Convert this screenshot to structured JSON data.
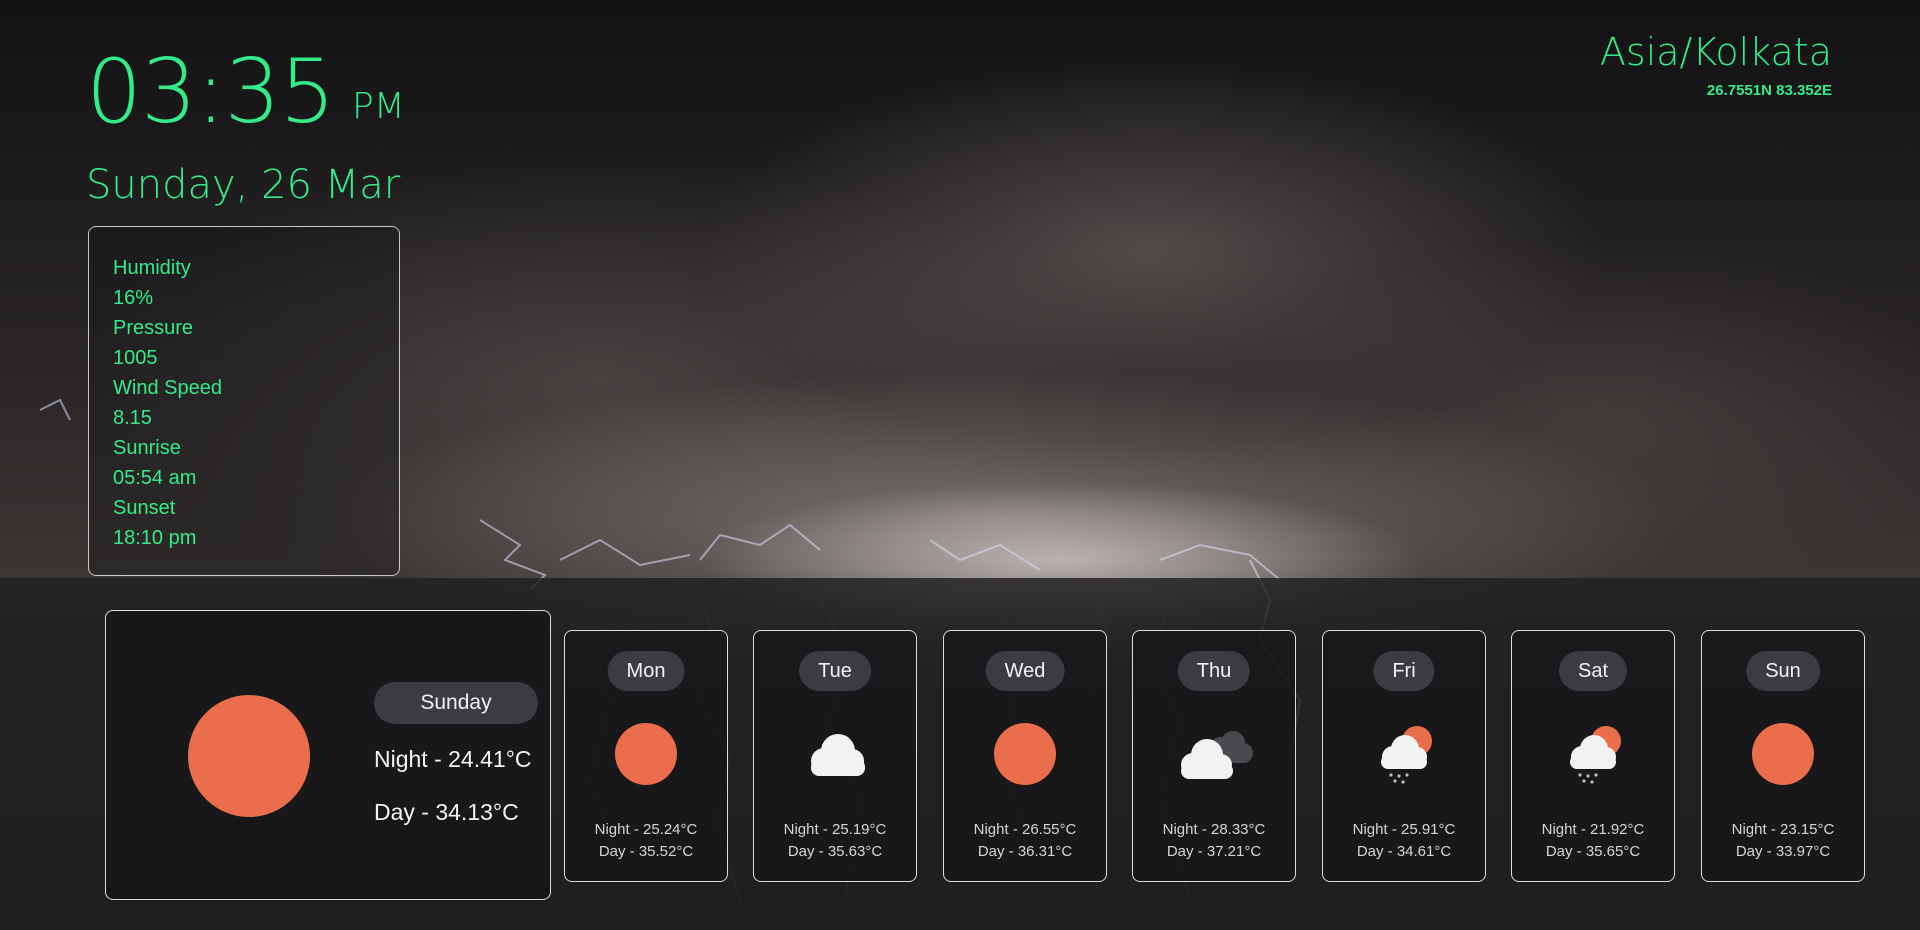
{
  "clock": {
    "time": "03:35",
    "period": "PM",
    "date": "Sunday, 26 Mar"
  },
  "location": {
    "timezone": "Asia/Kolkata",
    "coordinates": "26.7551N 83.352E"
  },
  "details": {
    "humidity_label": "Humidity",
    "humidity_value": "16%",
    "pressure_label": "Pressure",
    "pressure_value": "1005",
    "wind_label": "Wind Speed",
    "wind_value": "8.15",
    "sunrise_label": "Sunrise",
    "sunrise_value": "05:54 am",
    "sunset_label": "Sunset",
    "sunset_value": "18:10 pm"
  },
  "today": {
    "day": "Sunday",
    "icon": "sun-icon",
    "night": "Night - 24.41°C",
    "day_temp": "Day - 34.13°C"
  },
  "forecast": [
    {
      "day": "Mon",
      "icon": "sun-icon",
      "night": "Night - 25.24°C",
      "day_temp": "Day - 35.52°C"
    },
    {
      "day": "Tue",
      "icon": "cloud-icon",
      "night": "Night - 25.19°C",
      "day_temp": "Day - 35.63°C"
    },
    {
      "day": "Wed",
      "icon": "sun-icon",
      "night": "Night - 26.55°C",
      "day_temp": "Day - 36.31°C"
    },
    {
      "day": "Thu",
      "icon": "overcast-cloud-icon",
      "night": "Night - 28.33°C",
      "day_temp": "Day - 37.21°C"
    },
    {
      "day": "Fri",
      "icon": "rain-sun-cloud-icon",
      "night": "Night - 25.91°C",
      "day_temp": "Day - 34.61°C"
    },
    {
      "day": "Sat",
      "icon": "rain-sun-cloud-icon",
      "night": "Night - 21.92°C",
      "day_temp": "Day - 35.65°C"
    },
    {
      "day": "Sun",
      "icon": "sun-icon",
      "night": "Night - 23.15°C",
      "day_temp": "Day - 33.97°C"
    }
  ],
  "colors": {
    "accent": "#34eb8a",
    "sun": "#ea6e4c",
    "pill": "#3b3b42"
  }
}
